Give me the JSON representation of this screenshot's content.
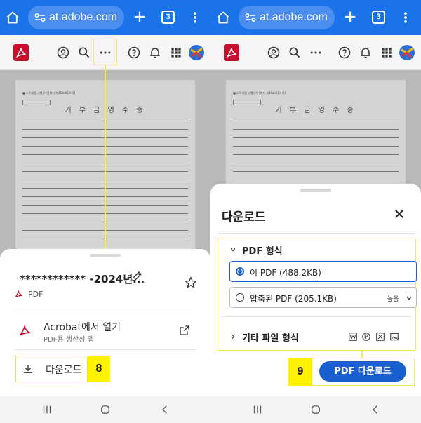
{
  "browser": {
    "url": "at.adobe.com",
    "tab_count": "3",
    "icons": [
      "home-icon",
      "site-info-icon",
      "plus-icon",
      "tab-switcher-icon",
      "more-vert-icon"
    ]
  },
  "acrobat_toolbar": {
    "icons": [
      "acrobat-logo-icon",
      "add-account-icon",
      "search-icon",
      "more-horiz-icon",
      "help-icon",
      "bell-icon",
      "apps-grid-icon",
      "avatar-icon"
    ]
  },
  "document": {
    "title": "기 부 금 영 수 증"
  },
  "left_sheet": {
    "file_name": "************ -2024년...",
    "file_type": "PDF",
    "open_in_acrobat": "Acrobat에서 열기",
    "open_in_acrobat_sub": "PDF용 생산성 앱",
    "download": "다운로드",
    "step_badge": "8"
  },
  "right_sheet": {
    "title": "다운로드",
    "pdf_format_section": "PDF 형식",
    "option_this_pdf": "이 PDF (488.2KB)",
    "option_compressed_pdf": "압축된 PDF (205.1KB)",
    "compression_level": "높음",
    "other_formats_section": "기타 파일 형식",
    "format_icons": [
      "word-icon",
      "powerpoint-icon",
      "excel-icon",
      "image-icon"
    ],
    "download_button": "PDF 다운로드",
    "step_badge": "9"
  },
  "colors": {
    "browser_blue": "#1a73e8",
    "acrobat_red": "#c8102e",
    "action_blue": "#1a5fcf",
    "annotation_yellow": "#fff200"
  }
}
